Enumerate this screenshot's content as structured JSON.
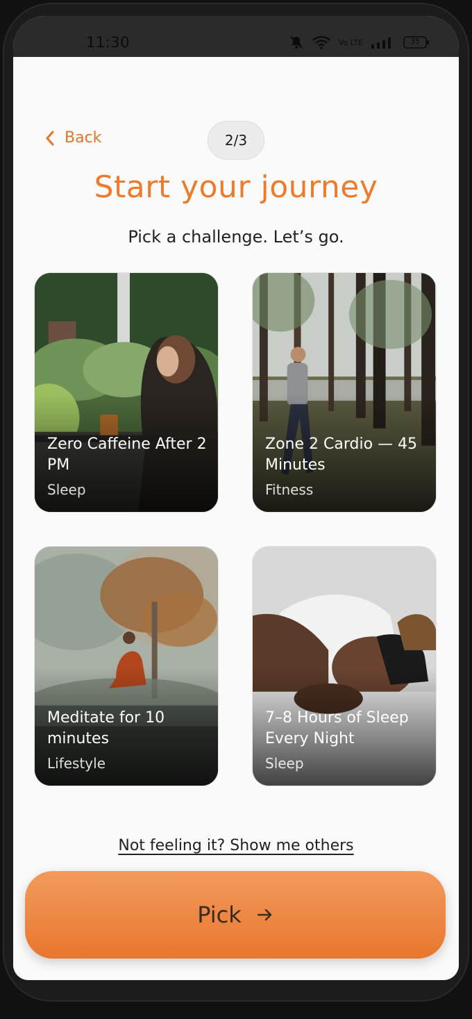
{
  "status_bar": {
    "time": "11:30",
    "icons": [
      "mute-icon",
      "wifi-icon",
      "volte-icon",
      "signal-icon",
      "battery-icon"
    ],
    "volte_text": "Vo LTE",
    "battery": "35"
  },
  "header": {
    "back_label": "Back",
    "step": "2/3"
  },
  "main": {
    "title": "Start your journey",
    "subtitle": "Pick a challenge. Let’s go.",
    "challenges": [
      {
        "title": "Zero Caffeine After 2 PM",
        "category": "Sleep"
      },
      {
        "title": "Zone 2 Cardio — 45 Minutes",
        "category": "Fitness"
      },
      {
        "title": "Meditate for 10 minutes",
        "category": "Lifestyle"
      },
      {
        "title": "7–8 Hours of Sleep Every Night",
        "category": "Sleep"
      }
    ],
    "others_link": "Not feeling it? Show me others"
  },
  "footer": {
    "pick_label": "Pick",
    "pick_icon": "arrow-right-icon"
  },
  "colors": {
    "accent": "#ee7b2a",
    "button_top": "#f29b5d",
    "button_bottom": "#e8762e"
  }
}
